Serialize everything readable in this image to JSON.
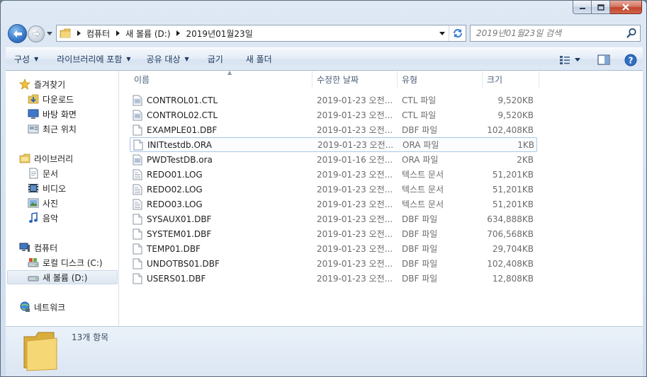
{
  "window": {
    "buttons": {
      "minimize": "minimize",
      "maximize": "maximize",
      "close": "close"
    }
  },
  "address": {
    "breadcrumbs": [
      "컴퓨터",
      "새 볼륨 (D:)",
      "2019년01월23일"
    ]
  },
  "search": {
    "placeholder": "2019년01월23일 검색"
  },
  "toolbar": {
    "organize": "구성",
    "include_library": "라이브러리에 포함",
    "share": "공유 대상",
    "burn": "굽기",
    "new_folder": "새 폴더"
  },
  "nav": {
    "favorites": "즐겨찾기",
    "downloads": "다운로드",
    "desktop": "바탕 화면",
    "recent": "최근 위치",
    "libraries": "라이브러리",
    "documents": "문서",
    "videos": "비디오",
    "pictures": "사진",
    "music": "음악",
    "computer": "컴퓨터",
    "local_disk": "로컬 디스크 (C:)",
    "new_volume": "새 볼륨 (D:)",
    "network": "네트워크"
  },
  "columns": {
    "name": "이름",
    "date": "수정한 날짜",
    "type": "유형",
    "size": "크기"
  },
  "files": [
    {
      "name": "CONTROL01.CTL",
      "date": "2019-01-23 오전...",
      "type": "CTL 파일",
      "size": "9,520KB",
      "icon": "config-file-icon"
    },
    {
      "name": "CONTROL02.CTL",
      "date": "2019-01-23 오전...",
      "type": "CTL 파일",
      "size": "9,520KB",
      "icon": "config-file-icon"
    },
    {
      "name": "EXAMPLE01.DBF",
      "date": "2019-01-23 오전...",
      "type": "DBF 파일",
      "size": "102,408KB",
      "icon": "blank-file-icon"
    },
    {
      "name": "INITtestdb.ORA",
      "date": "2019-01-23 오전...",
      "type": "ORA 파일",
      "size": "1KB",
      "icon": "blank-file-icon"
    },
    {
      "name": "PWDTestDB.ora",
      "date": "2019-01-16 오전...",
      "type": "ORA 파일",
      "size": "2KB",
      "icon": "config-file-icon"
    },
    {
      "name": "REDO01.LOG",
      "date": "2019-01-23 오전...",
      "type": "텍스트 문서",
      "size": "51,201KB",
      "icon": "text-file-icon"
    },
    {
      "name": "REDO02.LOG",
      "date": "2019-01-23 오전...",
      "type": "텍스트 문서",
      "size": "51,201KB",
      "icon": "text-file-icon"
    },
    {
      "name": "REDO03.LOG",
      "date": "2019-01-23 오전...",
      "type": "텍스트 문서",
      "size": "51,201KB",
      "icon": "text-file-icon"
    },
    {
      "name": "SYSAUX01.DBF",
      "date": "2019-01-23 오전...",
      "type": "DBF 파일",
      "size": "634,888KB",
      "icon": "blank-file-icon"
    },
    {
      "name": "SYSTEM01.DBF",
      "date": "2019-01-23 오전...",
      "type": "DBF 파일",
      "size": "706,568KB",
      "icon": "blank-file-icon"
    },
    {
      "name": "TEMP01.DBF",
      "date": "2019-01-23 오전...",
      "type": "DBF 파일",
      "size": "29,704KB",
      "icon": "blank-file-icon"
    },
    {
      "name": "UNDOTBS01.DBF",
      "date": "2019-01-23 오전...",
      "type": "DBF 파일",
      "size": "102,408KB",
      "icon": "blank-file-icon"
    },
    {
      "name": "USERS01.DBF",
      "date": "2019-01-23 오전...",
      "type": "DBF 파일",
      "size": "12,808KB",
      "icon": "blank-file-icon"
    }
  ],
  "details": {
    "count": "13개 항목"
  },
  "colors": {
    "accent": "#1e395b",
    "selection_border": "#a8c8ea",
    "window_bg": "#dfe9f5"
  }
}
